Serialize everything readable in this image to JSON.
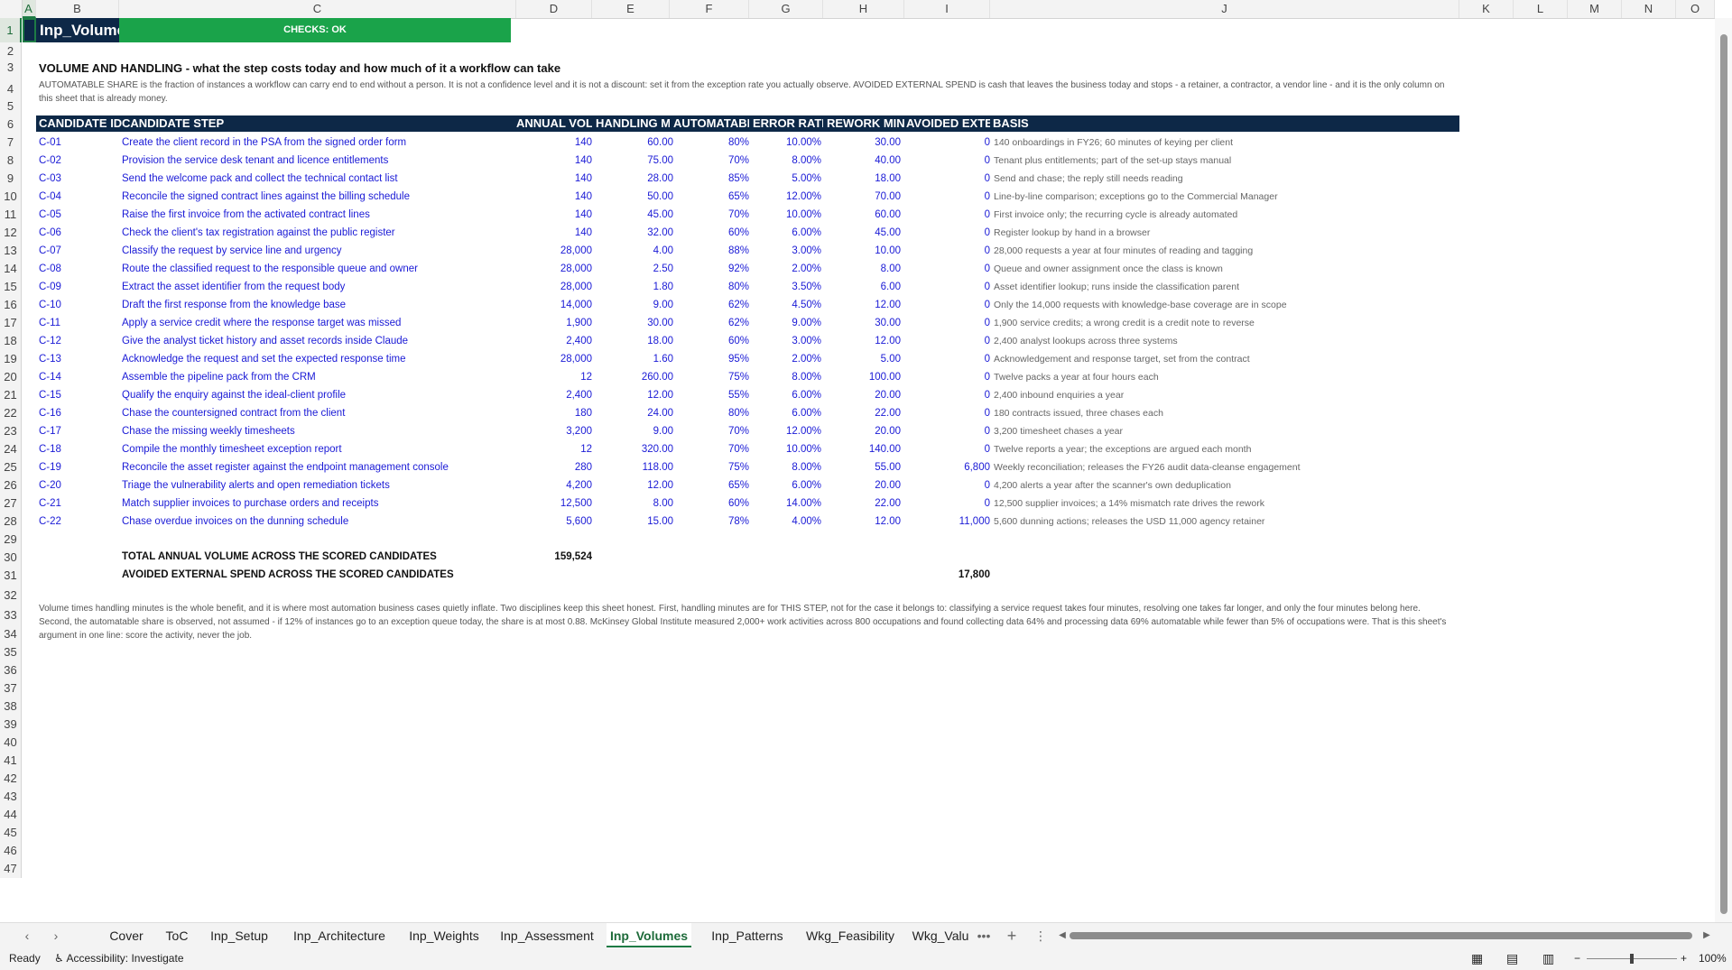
{
  "sheet": {
    "name_cell": "Inp_Volumes",
    "checks": "CHECKS: OK",
    "title": "VOLUME AND HANDLING - what the step costs today and how much of it a workflow can take",
    "intro": "AUTOMATABLE SHARE is the fraction of instances a workflow can carry end to end without a person. It is not a confidence level and it is not a discount: set it from the exception rate you actually observe. AVOIDED EXTERNAL SPEND is cash that leaves the business today and stops - a retainer, a contractor, a vendor line - and it is the only column on this sheet that is already money.",
    "headers": [
      "CANDIDATE ID",
      "CANDIDATE STEP",
      "ANNUAL VOLUME",
      "HANDLING MINUTES",
      "AUTOMATABLE SHARE",
      "ERROR RATE",
      "REWORK MINUTES",
      "AVOIDED EXTERNAL SPEND",
      "BASIS"
    ],
    "rows": [
      {
        "id": "C-01",
        "step": "Create the client record in the PSA from the signed order form",
        "vol": "140",
        "handling": "60.00",
        "auto": "80%",
        "err": "10.00%",
        "rework": "30.00",
        "spend": "0",
        "basis": "140 onboardings in FY26; 60 minutes of keying per client"
      },
      {
        "id": "C-02",
        "step": "Provision the service desk tenant and licence entitlements",
        "vol": "140",
        "handling": "75.00",
        "auto": "70%",
        "err": "8.00%",
        "rework": "40.00",
        "spend": "0",
        "basis": "Tenant plus entitlements; part of the set-up stays manual"
      },
      {
        "id": "C-03",
        "step": "Send the welcome pack and collect the technical contact list",
        "vol": "140",
        "handling": "28.00",
        "auto": "85%",
        "err": "5.00%",
        "rework": "18.00",
        "spend": "0",
        "basis": "Send and chase; the reply still needs reading"
      },
      {
        "id": "C-04",
        "step": "Reconcile the signed contract lines against the billing schedule",
        "vol": "140",
        "handling": "50.00",
        "auto": "65%",
        "err": "12.00%",
        "rework": "70.00",
        "spend": "0",
        "basis": "Line-by-line comparison; exceptions go to the Commercial Manager"
      },
      {
        "id": "C-05",
        "step": "Raise the first invoice from the activated contract lines",
        "vol": "140",
        "handling": "45.00",
        "auto": "70%",
        "err": "10.00%",
        "rework": "60.00",
        "spend": "0",
        "basis": "First invoice only; the recurring cycle is already automated"
      },
      {
        "id": "C-06",
        "step": "Check the client's tax registration against the public register",
        "vol": "140",
        "handling": "32.00",
        "auto": "60%",
        "err": "6.00%",
        "rework": "45.00",
        "spend": "0",
        "basis": "Register lookup by hand in a browser"
      },
      {
        "id": "C-07",
        "step": "Classify the request by service line and urgency",
        "vol": "28,000",
        "handling": "4.00",
        "auto": "88%",
        "err": "3.00%",
        "rework": "10.00",
        "spend": "0",
        "basis": "28,000 requests a year at four minutes of reading and tagging"
      },
      {
        "id": "C-08",
        "step": "Route the classified request to the responsible queue and owner",
        "vol": "28,000",
        "handling": "2.50",
        "auto": "92%",
        "err": "2.00%",
        "rework": "8.00",
        "spend": "0",
        "basis": "Queue and owner assignment once the class is known"
      },
      {
        "id": "C-09",
        "step": "Extract the asset identifier from the request body",
        "vol": "28,000",
        "handling": "1.80",
        "auto": "80%",
        "err": "3.50%",
        "rework": "6.00",
        "spend": "0",
        "basis": "Asset identifier lookup; runs inside the classification parent"
      },
      {
        "id": "C-10",
        "step": "Draft the first response from the knowledge base",
        "vol": "14,000",
        "handling": "9.00",
        "auto": "62%",
        "err": "4.50%",
        "rework": "12.00",
        "spend": "0",
        "basis": "Only the 14,000 requests with knowledge-base coverage are in scope"
      },
      {
        "id": "C-11",
        "step": "Apply a service credit where the response target was missed",
        "vol": "1,900",
        "handling": "30.00",
        "auto": "62%",
        "err": "9.00%",
        "rework": "30.00",
        "spend": "0",
        "basis": "1,900 service credits; a wrong credit is a credit note to reverse"
      },
      {
        "id": "C-12",
        "step": "Give the analyst ticket history and asset records inside Claude",
        "vol": "2,400",
        "handling": "18.00",
        "auto": "60%",
        "err": "3.00%",
        "rework": "12.00",
        "spend": "0",
        "basis": "2,400 analyst lookups across three systems"
      },
      {
        "id": "C-13",
        "step": "Acknowledge the request and set the expected response time",
        "vol": "28,000",
        "handling": "1.60",
        "auto": "95%",
        "err": "2.00%",
        "rework": "5.00",
        "spend": "0",
        "basis": "Acknowledgement and response target, set from the contract"
      },
      {
        "id": "C-14",
        "step": "Assemble the pipeline pack from the CRM",
        "vol": "12",
        "handling": "260.00",
        "auto": "75%",
        "err": "8.00%",
        "rework": "100.00",
        "spend": "0",
        "basis": "Twelve packs a year at four hours each"
      },
      {
        "id": "C-15",
        "step": "Qualify the enquiry against the ideal-client profile",
        "vol": "2,400",
        "handling": "12.00",
        "auto": "55%",
        "err": "6.00%",
        "rework": "20.00",
        "spend": "0",
        "basis": "2,400 inbound enquiries a year"
      },
      {
        "id": "C-16",
        "step": "Chase the countersigned contract from the client",
        "vol": "180",
        "handling": "24.00",
        "auto": "80%",
        "err": "6.00%",
        "rework": "22.00",
        "spend": "0",
        "basis": "180 contracts issued, three chases each"
      },
      {
        "id": "C-17",
        "step": "Chase the missing weekly timesheets",
        "vol": "3,200",
        "handling": "9.00",
        "auto": "70%",
        "err": "12.00%",
        "rework": "20.00",
        "spend": "0",
        "basis": "3,200 timesheet chases a year"
      },
      {
        "id": "C-18",
        "step": "Compile the monthly timesheet exception report",
        "vol": "12",
        "handling": "320.00",
        "auto": "70%",
        "err": "10.00%",
        "rework": "140.00",
        "spend": "0",
        "basis": "Twelve reports a year; the exceptions are argued each month"
      },
      {
        "id": "C-19",
        "step": "Reconcile the asset register against the endpoint management console",
        "vol": "280",
        "handling": "118.00",
        "auto": "75%",
        "err": "8.00%",
        "rework": "55.00",
        "spend": "6,800",
        "basis": "Weekly reconciliation; releases the FY26 audit data-cleanse engagement"
      },
      {
        "id": "C-20",
        "step": "Triage the vulnerability alerts and open remediation tickets",
        "vol": "4,200",
        "handling": "12.00",
        "auto": "65%",
        "err": "6.00%",
        "rework": "20.00",
        "spend": "0",
        "basis": "4,200 alerts a year after the scanner's own deduplication"
      },
      {
        "id": "C-21",
        "step": "Match supplier invoices to purchase orders and receipts",
        "vol": "12,500",
        "handling": "8.00",
        "auto": "60%",
        "err": "14.00%",
        "rework": "22.00",
        "spend": "0",
        "basis": "12,500 supplier invoices; a 14% mismatch rate drives the rework"
      },
      {
        "id": "C-22",
        "step": "Chase overdue invoices on the dunning schedule",
        "vol": "5,600",
        "handling": "15.00",
        "auto": "78%",
        "err": "4.00%",
        "rework": "12.00",
        "spend": "11,000",
        "basis": "5,600 dunning actions; releases the USD 11,000 agency retainer"
      }
    ],
    "total_volume_label": "TOTAL ANNUAL VOLUME ACROSS THE SCORED CANDIDATES",
    "total_volume": "159,524",
    "total_spend_label": "AVOIDED EXTERNAL SPEND ACROSS THE SCORED CANDIDATES",
    "total_spend": "17,800",
    "note": "Volume times handling minutes is the whole benefit, and it is where most automation business cases quietly inflate. Two disciplines keep this sheet honest. First, handling minutes are for THIS STEP, not for the case it belongs to: classifying a service request takes four minutes, resolving one takes far longer, and only the four minutes belong here. Second, the automatable share is observed, not assumed - if 12% of instances go to an exception queue today, the share is at most 0.88.  McKinsey Global Institute measured 2,000+ work activities across 800 occupations and found collecting data 64% and processing data 69% automatable while fewer than 5% of occupations were. That is this sheet's argument in one line: score the activity, never the job."
  },
  "columns": [
    "A",
    "B",
    "C",
    "D",
    "E",
    "F",
    "G",
    "H",
    "I",
    "J",
    "K",
    "L",
    "M",
    "N",
    "O"
  ],
  "row_numbers": [
    "1",
    "2",
    "3",
    "4",
    "5",
    "6",
    "7",
    "8",
    "9",
    "10",
    "11",
    "12",
    "13",
    "14",
    "15",
    "16",
    "17",
    "18",
    "19",
    "20",
    "21",
    "22",
    "23",
    "24",
    "25",
    "26",
    "27",
    "28",
    "29",
    "30",
    "31",
    "32",
    "33",
    "34",
    "35",
    "36",
    "37",
    "38",
    "39",
    "40",
    "41",
    "42",
    "43",
    "44",
    "45",
    "46",
    "47"
  ],
  "tabs": [
    "Cover",
    "ToC",
    "Inp_Setup",
    "Inp_Architecture",
    "Inp_Weights",
    "Inp_Assessment",
    "Inp_Volumes",
    "Inp_Patterns",
    "Wkg_Feasibility",
    "Wkg_Valu"
  ],
  "active_tab": "Inp_Volumes",
  "tab_more": "•••",
  "add_sheet": "+",
  "sheet_menu": "⋮",
  "status": {
    "ready": "Ready",
    "accessibility": "Accessibility: Investigate",
    "zoom_minus": "−",
    "zoom_plus": "+",
    "zoom": "100%"
  },
  "colors": {
    "header_band": "#0d2847",
    "checks_ok": "#1aa34a",
    "input_blue": "#1a1ad6",
    "accent": "#1e7b45"
  }
}
